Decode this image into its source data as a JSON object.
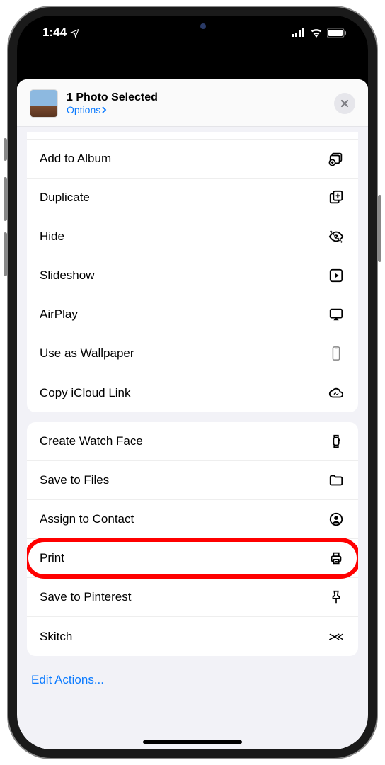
{
  "status": {
    "time": "1:44"
  },
  "header": {
    "title": "1 Photo Selected",
    "options": "Options"
  },
  "groups": [
    {
      "cutTop": true,
      "peek": true,
      "items": [
        {
          "key": "add-to-album",
          "label": "Add to Album",
          "icon": "album-add"
        },
        {
          "key": "duplicate",
          "label": "Duplicate",
          "icon": "duplicate"
        },
        {
          "key": "hide",
          "label": "Hide",
          "icon": "eye-off"
        },
        {
          "key": "slideshow",
          "label": "Slideshow",
          "icon": "play"
        },
        {
          "key": "airplay",
          "label": "AirPlay",
          "icon": "airplay"
        },
        {
          "key": "wallpaper",
          "label": "Use as Wallpaper",
          "icon": "phone"
        },
        {
          "key": "icloud-link",
          "label": "Copy iCloud Link",
          "icon": "cloud-link"
        }
      ]
    },
    {
      "cutTop": false,
      "peek": false,
      "items": [
        {
          "key": "watch-face",
          "label": "Create Watch Face",
          "icon": "watch"
        },
        {
          "key": "save-files",
          "label": "Save to Files",
          "icon": "folder"
        },
        {
          "key": "assign-contact",
          "label": "Assign to Contact",
          "icon": "contact"
        },
        {
          "key": "print",
          "label": "Print",
          "icon": "printer",
          "highlighted": true
        },
        {
          "key": "pinterest",
          "label": "Save to Pinterest",
          "icon": "pin"
        },
        {
          "key": "skitch",
          "label": "Skitch",
          "icon": "skitch"
        }
      ]
    }
  ],
  "footer": {
    "edit": "Edit Actions..."
  }
}
